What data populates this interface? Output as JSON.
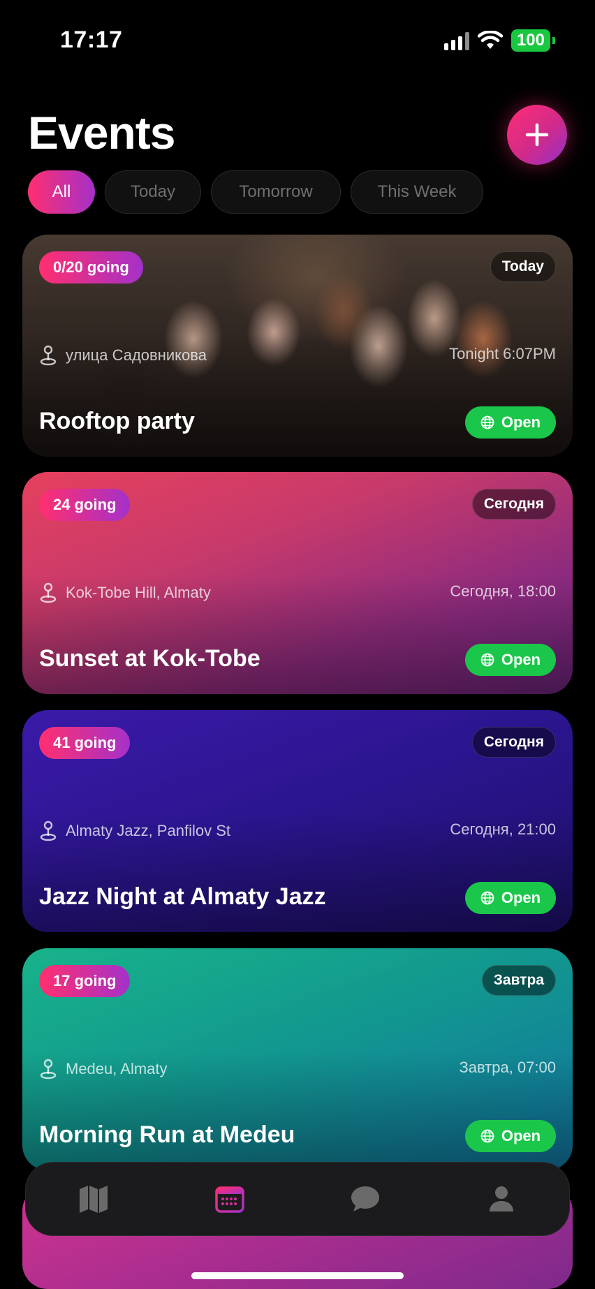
{
  "status": {
    "time": "17:17",
    "battery": "100"
  },
  "header": {
    "title": "Events",
    "add_icon": "plus-icon"
  },
  "filters": [
    {
      "label": "All",
      "active": true
    },
    {
      "label": "Today",
      "active": false
    },
    {
      "label": "Tomorrow",
      "active": false
    },
    {
      "label": "This Week",
      "active": false
    }
  ],
  "events": [
    {
      "going": "0/20 going",
      "day": "Today",
      "location": "улица Садовникова",
      "time": "Tonight 6:07PM",
      "title": "Rooftop party",
      "open_label": "Open",
      "background": "photo"
    },
    {
      "going": "24 going",
      "day": "Сегодня",
      "location": "Kok-Tobe Hill, Almaty",
      "time": "Сегодня, 18:00",
      "title": "Sunset at Kok-Tobe",
      "open_label": "Open",
      "background": "#d63d63"
    },
    {
      "going": "41 going",
      "day": "Сегодня",
      "location": "Almaty Jazz, Panfilov St",
      "time": "Сегодня, 21:00",
      "title": "Jazz Night at Almaty Jazz",
      "open_label": "Open",
      "background": "#2c1590"
    },
    {
      "going": "17 going",
      "day": "Завтра",
      "location": "Medeu, Almaty",
      "time": "Завтра, 07:00",
      "title": "Morning Run at Medeu",
      "open_label": "Open",
      "background": "#12988f"
    }
  ],
  "tab_bar": [
    {
      "icon": "map-icon",
      "active": false
    },
    {
      "icon": "calendar-icon",
      "active": true
    },
    {
      "icon": "chat-bubble-icon",
      "active": false
    },
    {
      "icon": "profile-icon",
      "active": false
    }
  ],
  "colors": {
    "accent_start": "#ff2f6f",
    "accent_end": "#a431c9",
    "open_green": "#1ac74a",
    "inactive_icon": "#6a6a6a"
  }
}
